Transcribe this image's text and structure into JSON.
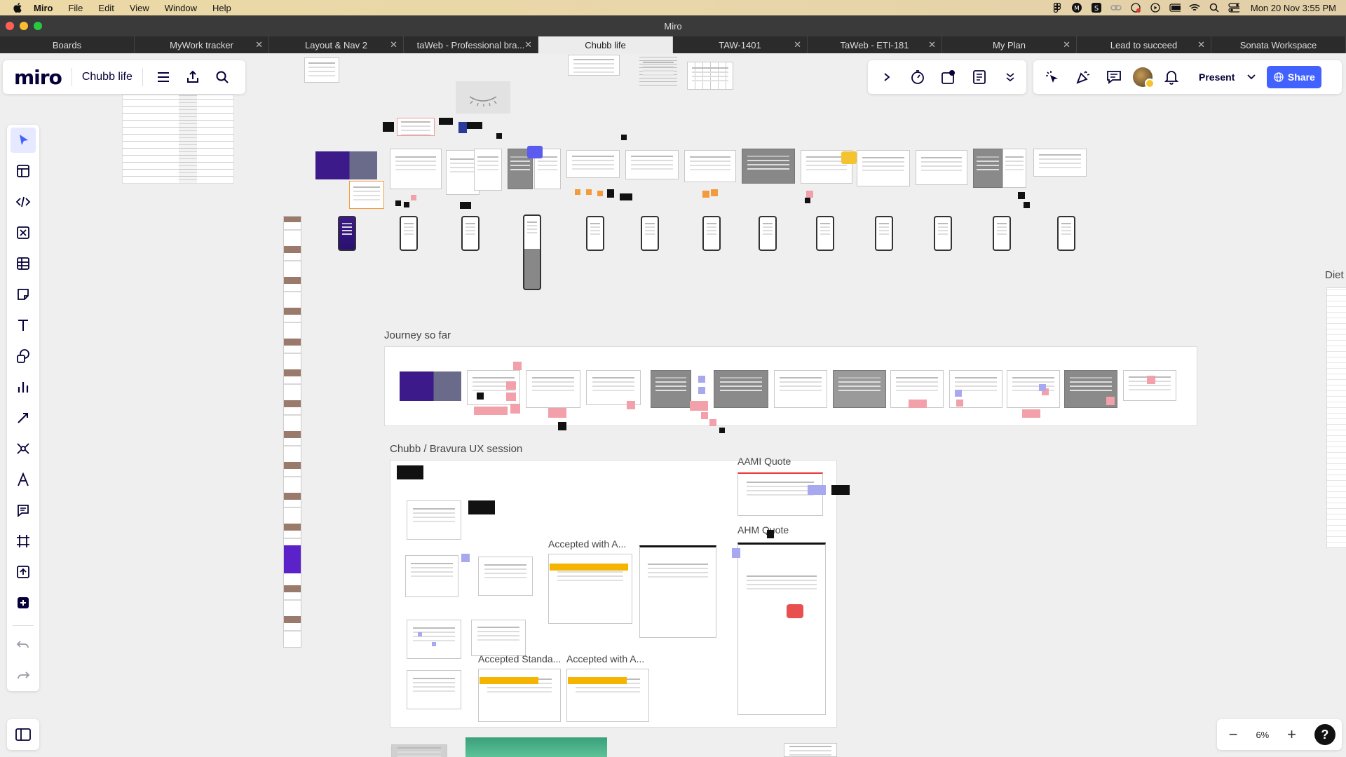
{
  "menubar": {
    "app": "Miro",
    "items": [
      "File",
      "Edit",
      "View",
      "Window",
      "Help"
    ],
    "clock": "Mon 20 Nov  3:55 PM"
  },
  "window": {
    "title": "Miro"
  },
  "tabs": [
    {
      "label": "Boards",
      "closable": false
    },
    {
      "label": "MyWork tracker",
      "closable": true
    },
    {
      "label": "Layout & Nav 2",
      "closable": true
    },
    {
      "label": "taWeb - Professional bra...",
      "closable": true
    },
    {
      "label": "Chubb life",
      "closable": false,
      "active": true
    },
    {
      "label": "TAW-1401",
      "closable": true
    },
    {
      "label": "TaWeb - ETI-181",
      "closable": true
    },
    {
      "label": "My Plan",
      "closable": true
    },
    {
      "label": "Lead to succeed",
      "closable": true
    },
    {
      "label": "Sonata Workspace",
      "closable": false
    }
  ],
  "board": {
    "logo": "miro",
    "name": "Chubb life"
  },
  "topright": {
    "present_label": "Present",
    "share_label": "Share"
  },
  "canvas": {
    "labels": {
      "journey": "Journey so far",
      "session": "Chubb / Bravura UX session",
      "aami": "AAMI Quote",
      "ahm": "AHM Quote",
      "accepted1": "Accepted with A...",
      "accepted_std": "Accepted Standa...",
      "accepted2": "Accepted with A...",
      "diet": "Diet"
    }
  },
  "zoom": {
    "level": "6%",
    "minus": "−",
    "plus": "+",
    "help": "?"
  },
  "colors": {
    "accent": "#4262ff",
    "brand_purple": "#3c1a8a",
    "sticky_pink": "#f2a0aa"
  }
}
